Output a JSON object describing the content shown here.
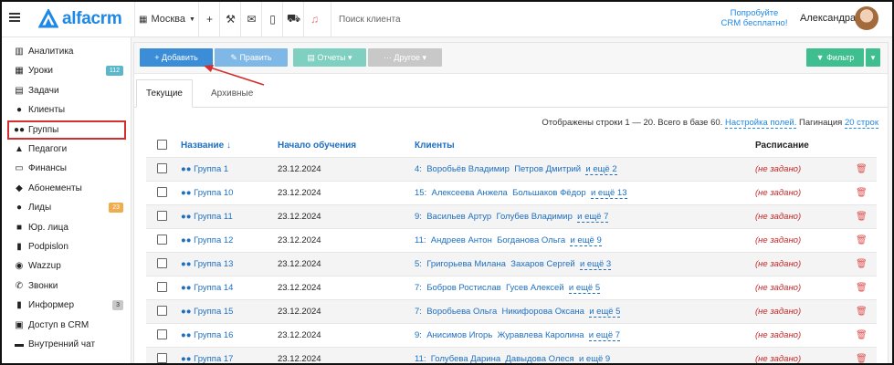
{
  "topbar": {
    "logo_text": "alfacrm",
    "branch": "Москва",
    "search_placeholder": "Поиск клиента",
    "promo_line1": "Попробуйте",
    "promo_line2": "CRM бесплатно!",
    "user_name": "Александра"
  },
  "sidebar": {
    "items": [
      {
        "label": "Аналитика",
        "icon": "map-icon",
        "glyph": "▥"
      },
      {
        "label": "Уроки",
        "icon": "calendar-icon",
        "glyph": "▦",
        "badge": "112",
        "badge_color": "#5bb7c9"
      },
      {
        "label": "Задачи",
        "icon": "clipboard-icon",
        "glyph": "▤"
      },
      {
        "label": "Клиенты",
        "icon": "user-icon",
        "glyph": "●"
      },
      {
        "label": "Группы",
        "icon": "users-icon",
        "glyph": "●●"
      },
      {
        "label": "Педагоги",
        "icon": "graduation-cap-icon",
        "glyph": "▲"
      },
      {
        "label": "Финансы",
        "icon": "money-icon",
        "glyph": "▭"
      },
      {
        "label": "Абонементы",
        "icon": "ticket-icon",
        "glyph": "◆"
      },
      {
        "label": "Лиды",
        "icon": "user-plus-icon",
        "glyph": "●",
        "badge": "23",
        "badge_color": "#f0ad4e"
      },
      {
        "label": "Юр. лица",
        "icon": "briefcase-icon",
        "glyph": "■"
      },
      {
        "label": "Podpislon",
        "icon": "file-icon",
        "glyph": "▮"
      },
      {
        "label": "Wazzup",
        "icon": "whatsapp-icon",
        "glyph": "◉"
      },
      {
        "label": "Звонки",
        "icon": "phone-icon",
        "glyph": "✆"
      },
      {
        "label": "Информер",
        "icon": "file-text-icon",
        "glyph": "▮",
        "badge": "3",
        "badge_color": "#c8c8c8"
      },
      {
        "label": "Доступ в CRM",
        "icon": "lock-icon",
        "glyph": "▣"
      },
      {
        "label": "Внутренний чат",
        "icon": "chat-icon",
        "glyph": "▬"
      }
    ]
  },
  "toolbar": {
    "add": "+ Добавить",
    "edit": "✎ Править",
    "reports": "▤ Отчеты ▾",
    "other": "··· Другое ▾",
    "filter": "▼ Фильтр",
    "filter_caret": "▾"
  },
  "tabs": {
    "current": "Текущие",
    "archive": "Архивные"
  },
  "info": {
    "text": "Отображены строки 1 — 20. Всего в базе 60.",
    "settings": "Настройка полей.",
    "pagination_label": "Пагинация",
    "pagination_value": "20 строк"
  },
  "table": {
    "headers": {
      "name": "Название ↓",
      "start": "Начало обучения",
      "clients": "Клиенты",
      "schedule": "Расписание"
    },
    "rows": [
      {
        "name": "Группа 1",
        "date": "23.12.2024",
        "count": "4:",
        "c1": "Воробьёв Владимир",
        "c2": "Петров Дмитрий",
        "more": "и ещё 2",
        "sched": "(не задано)"
      },
      {
        "name": "Группа 10",
        "date": "23.12.2024",
        "count": "15:",
        "c1": "Алексеева Анжела",
        "c2": "Большаков Фёдор",
        "more": "и ещё 13",
        "sched": "(не задано)"
      },
      {
        "name": "Группа 11",
        "date": "23.12.2024",
        "count": "9:",
        "c1": "Васильев Артур",
        "c2": "Голубев Владимир",
        "more": "и ещё 7",
        "sched": "(не задано)"
      },
      {
        "name": "Группа 12",
        "date": "23.12.2024",
        "count": "11:",
        "c1": "Андреев Антон",
        "c2": "Богданова Ольга",
        "more": "и ещё 9",
        "sched": "(не задано)"
      },
      {
        "name": "Группа 13",
        "date": "23.12.2024",
        "count": "5:",
        "c1": "Григорьева Милана",
        "c2": "Захаров Сергей",
        "more": "и ещё 3",
        "sched": "(не задано)"
      },
      {
        "name": "Группа 14",
        "date": "23.12.2024",
        "count": "7:",
        "c1": "Бобров Ростислав",
        "c2": "Гусев Алексей",
        "more": "и ещё 5",
        "sched": "(не задано)"
      },
      {
        "name": "Группа 15",
        "date": "23.12.2024",
        "count": "7:",
        "c1": "Воробьева Ольга",
        "c2": "Никифорова Оксана",
        "more": "и ещё 5",
        "sched": "(не задано)"
      },
      {
        "name": "Группа 16",
        "date": "23.12.2024",
        "count": "9:",
        "c1": "Анисимов Игорь",
        "c2": "Журавлева Каролина",
        "more": "и ещё 7",
        "sched": "(не задано)"
      },
      {
        "name": "Группа 17",
        "date": "23.12.2024",
        "count": "11:",
        "c1": "Голубева Дарина",
        "c2": "Давыдова Олеся",
        "more": "и ещё 9",
        "sched": "(не задано)"
      }
    ]
  },
  "colors": {
    "accent": "#1e88e5",
    "add_button": "#3a8dd6",
    "filter_button": "#3fbf8f",
    "highlight": "#d32f2f"
  }
}
